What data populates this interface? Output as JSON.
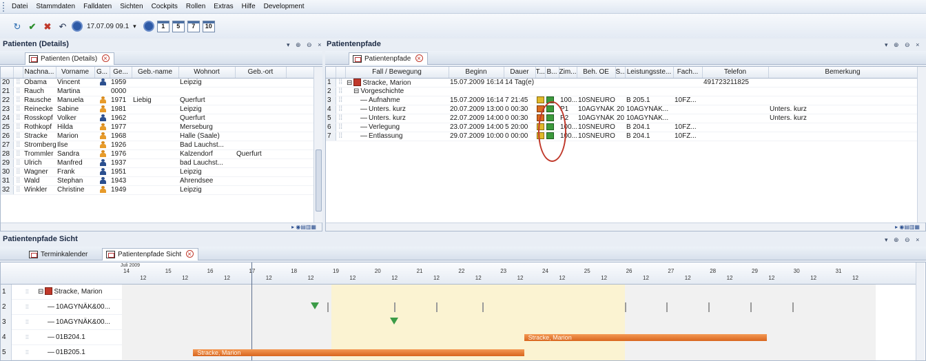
{
  "menu": [
    "Datei",
    "Stammdaten",
    "Falldaten",
    "Sichten",
    "Cockpits",
    "Rollen",
    "Extras",
    "Hilfe",
    "Development"
  ],
  "toolbar": {
    "date": "17.07.09 09.1",
    "calendar_buttons": [
      "1",
      "5",
      "7",
      "10"
    ]
  },
  "left_panel": {
    "title": "Patienten (Details)",
    "tab_label": "Patienten (Details)",
    "columns": [
      "Nachna...",
      "Vorname",
      "G...",
      "Ge...",
      "Geb.-name",
      "Wohnort",
      "Geb.-ort"
    ],
    "rows": [
      {
        "num": "20",
        "last": "Obama",
        "first": "Vincent",
        "g": "m",
        "year": "1959",
        "birthname": "",
        "city": "Leipzig",
        "birthplace": ""
      },
      {
        "num": "21",
        "last": "Rauch",
        "first": "Martina",
        "g": "",
        "year": "0000",
        "birthname": "",
        "city": "",
        "birthplace": ""
      },
      {
        "num": "22",
        "last": "Rausche",
        "first": "Manuela",
        "g": "f",
        "year": "1971",
        "birthname": "Liebig",
        "city": "Querfurt",
        "birthplace": ""
      },
      {
        "num": "23",
        "last": "Reinecke",
        "first": "Sabine",
        "g": "f",
        "year": "1981",
        "birthname": "",
        "city": "Leipzig",
        "birthplace": ""
      },
      {
        "num": "24",
        "last": "Rosskopf",
        "first": "Volker",
        "g": "m",
        "year": "1962",
        "birthname": "",
        "city": "Querfurt",
        "birthplace": ""
      },
      {
        "num": "25",
        "last": "Rothkopf",
        "first": "Hilda",
        "g": "f",
        "year": "1977",
        "birthname": "",
        "city": "Merseburg",
        "birthplace": ""
      },
      {
        "num": "26",
        "last": "Stracke",
        "first": "Marion",
        "g": "f",
        "year": "1968",
        "birthname": "",
        "city": "Halle (Saale)",
        "birthplace": ""
      },
      {
        "num": "27",
        "last": "Stromberg",
        "first": "Ilse",
        "g": "f",
        "year": "1926",
        "birthname": "",
        "city": "Bad Lauchst...",
        "birthplace": ""
      },
      {
        "num": "28",
        "last": "Trommler",
        "first": "Sandra",
        "g": "f",
        "year": "1976",
        "birthname": "",
        "city": "Kalzendorf",
        "birthplace": "Querfurt"
      },
      {
        "num": "29",
        "last": "Ulrich",
        "first": "Manfred",
        "g": "m",
        "year": "1937",
        "birthname": "",
        "city": "bad Lauchst...",
        "birthplace": ""
      },
      {
        "num": "30",
        "last": "Wagner",
        "first": "Frank",
        "g": "m",
        "year": "1951",
        "birthname": "",
        "city": "Leipzig",
        "birthplace": ""
      },
      {
        "num": "31",
        "last": "Wald",
        "first": "Stephan",
        "g": "m",
        "year": "1943",
        "birthname": "",
        "city": "Ahrendsee",
        "birthplace": ""
      },
      {
        "num": "32",
        "last": "Winkler",
        "first": "Christine",
        "g": "f",
        "year": "1949",
        "birthname": "",
        "city": "Leipzig",
        "birthplace": ""
      }
    ]
  },
  "right_panel": {
    "title": "Patientenpfade",
    "tab_label": "Patientenpfade",
    "columns": [
      "Fall / Bewegung",
      "Beginn",
      "Dauer",
      "T...",
      "B...",
      "Zim...",
      "Beh. OE",
      "S...",
      "Leistungsste...",
      "Fach...",
      "Telefon",
      "Bemerkung"
    ],
    "rows": [
      {
        "num": "1",
        "indent": 0,
        "label": "Stracke, Marion",
        "begin": "15.07.2009 16:14",
        "duration": "14 Tag(e)",
        "zim": "",
        "oe": "",
        "s": "",
        "ls": "",
        "fach": "",
        "tel": "491723211825",
        "note": ""
      },
      {
        "num": "2",
        "indent": 1,
        "label": "Vorgeschichte",
        "begin": "",
        "duration": "",
        "zim": "",
        "oe": "",
        "s": "",
        "ls": "",
        "fach": "",
        "tel": "",
        "note": ""
      },
      {
        "num": "3",
        "indent": 2,
        "label": "Aufnahme",
        "begin": "15.07.2009 16:14",
        "duration": "7 21:45",
        "zim": "100...",
        "oe": "10SNEURO",
        "s": "",
        "ls": "B 205.1",
        "fach": "10FZ...",
        "tel": "",
        "note": ""
      },
      {
        "num": "4",
        "indent": 2,
        "label": "Unters. kurz",
        "begin": "20.07.2009 13:00",
        "duration": "0 00:30",
        "zim": "P1",
        "oe": "10AGYNÄK",
        "s": "20",
        "ls": "10AGYNÄK...",
        "fach": "",
        "tel": "",
        "note": "Unters. kurz"
      },
      {
        "num": "5",
        "indent": 2,
        "label": "Unters. kurz",
        "begin": "22.07.2009 14:00",
        "duration": "0 00:30",
        "zim": "P2",
        "oe": "10AGYNÄK",
        "s": "20",
        "ls": "10AGYNÄK...",
        "fach": "",
        "tel": "",
        "note": "Unters. kurz"
      },
      {
        "num": "6",
        "indent": 2,
        "label": "Verlegung",
        "begin": "23.07.2009 14:00",
        "duration": "5 20:00",
        "zim": "100...",
        "oe": "10SNEURO",
        "s": "",
        "ls": "B 204.1",
        "fach": "10FZ...",
        "tel": "",
        "note": ""
      },
      {
        "num": "7",
        "indent": 2,
        "label": "Entlassung",
        "begin": "29.07.2009 10:00",
        "duration": "0 00:00",
        "zim": "100...",
        "oe": "10SNEURO",
        "s": "",
        "ls": "B 204.1",
        "fach": "10FZ...",
        "tel": "",
        "note": ""
      }
    ]
  },
  "bottom_panel": {
    "title": "Patientenpfade Sicht",
    "tabs": [
      "Terminkalender",
      "Patientenpfade Sicht"
    ],
    "month_label": "Juli 2009",
    "days": [
      "14",
      "15",
      "16",
      "17",
      "18",
      "19",
      "20",
      "21",
      "22",
      "23",
      "24",
      "25",
      "26",
      "27",
      "28",
      "29",
      "30",
      "31"
    ],
    "half_label": "12",
    "rows": [
      {
        "num": "1",
        "label": "Stracke, Marion"
      },
      {
        "num": "2",
        "label": "10AGYNÄK&00..."
      },
      {
        "num": "3",
        "label": "10AGYNÄK&00..."
      },
      {
        "num": "4",
        "label": "01B204.1"
      },
      {
        "num": "5",
        "label": "01B205.1"
      }
    ],
    "bars": [
      {
        "row": 3,
        "label": "Stracke, Marion",
        "start_day": 23.6,
        "end_day": 29.4
      },
      {
        "row": 4,
        "label": "Stracke, Marion",
        "start_day": 15.7,
        "end_day": 23.6
      }
    ]
  },
  "colors": {
    "accent": "#2b4f8f",
    "bar": "#e07a30",
    "marker": "#3b9b47",
    "highlight": "#c0392b"
  }
}
